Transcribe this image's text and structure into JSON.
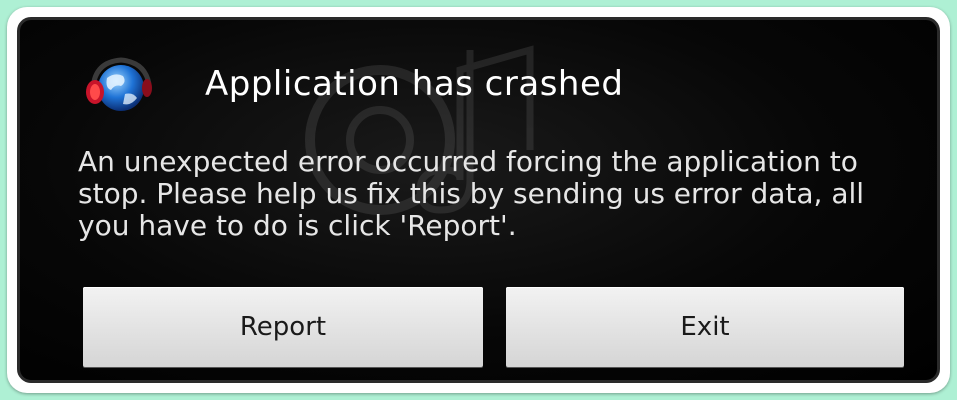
{
  "dialog": {
    "title": "Application has crashed",
    "message": "An unexpected error occurred forcing the application to stop. Please help us fix this by sending us error data, all you have to do is click 'Report'.",
    "icon": "globe-headphones-icon"
  },
  "buttons": {
    "report_label": "Report",
    "exit_label": "Exit"
  },
  "colors": {
    "page_background": "#aef0d4",
    "dialog_background": "#000000",
    "button_background": "#e6e6e6",
    "title_text": "#ffffff"
  }
}
